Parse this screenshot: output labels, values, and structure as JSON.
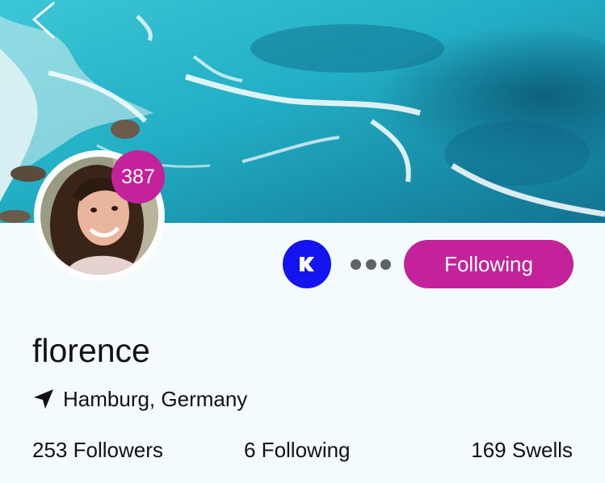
{
  "profile": {
    "name": "florence",
    "location": "Hamburg, Germany",
    "badge_count": "387",
    "follow_button_label": "Following",
    "stats": {
      "followers": "253 Followers",
      "following": "6 Following",
      "swells": "169 Swells"
    }
  },
  "icons": {
    "back": "chevron-left-icon",
    "location": "location-arrow-icon",
    "more": "more-dots-icon",
    "app_logo": "k-logo-icon"
  },
  "colors": {
    "accent": "#c3229a",
    "app_logo_bg": "#1414f0",
    "page_bg": "#f4fbfc"
  }
}
